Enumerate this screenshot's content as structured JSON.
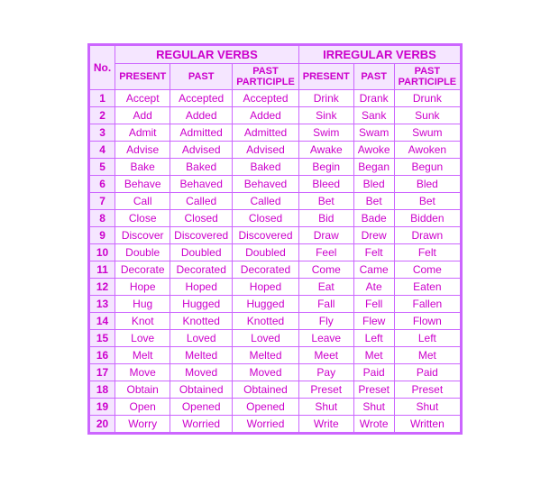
{
  "table": {
    "sections": {
      "regular": "REGULAR VERBS",
      "irregular": "IRREGULAR VERBS"
    },
    "col_headers": {
      "no": "No.",
      "present": "PRESENT",
      "past": "PAST",
      "past_participle": "PAST\nPARTICIPLE"
    },
    "rows": [
      {
        "no": "1",
        "r_present": "Accept",
        "r_past": "Accepted",
        "r_pp": "Accepted",
        "i_present": "Drink",
        "i_past": "Drank",
        "i_pp": "Drunk"
      },
      {
        "no": "2",
        "r_present": "Add",
        "r_past": "Added",
        "r_pp": "Added",
        "i_present": "Sink",
        "i_past": "Sank",
        "i_pp": "Sunk"
      },
      {
        "no": "3",
        "r_present": "Admit",
        "r_past": "Admitted",
        "r_pp": "Admitted",
        "i_present": "Swim",
        "i_past": "Swam",
        "i_pp": "Swum"
      },
      {
        "no": "4",
        "r_present": "Advise",
        "r_past": "Advised",
        "r_pp": "Advised",
        "i_present": "Awake",
        "i_past": "Awoke",
        "i_pp": "Awoken"
      },
      {
        "no": "5",
        "r_present": "Bake",
        "r_past": "Baked",
        "r_pp": "Baked",
        "i_present": "Begin",
        "i_past": "Began",
        "i_pp": "Begun"
      },
      {
        "no": "6",
        "r_present": "Behave",
        "r_past": "Behaved",
        "r_pp": "Behaved",
        "i_present": "Bleed",
        "i_past": "Bled",
        "i_pp": "Bled"
      },
      {
        "no": "7",
        "r_present": "Call",
        "r_past": "Called",
        "r_pp": "Called",
        "i_present": "Bet",
        "i_past": "Bet",
        "i_pp": "Bet"
      },
      {
        "no": "8",
        "r_present": "Close",
        "r_past": "Closed",
        "r_pp": "Closed",
        "i_present": "Bid",
        "i_past": "Bade",
        "i_pp": "Bidden"
      },
      {
        "no": "9",
        "r_present": "Discover",
        "r_past": "Discovered",
        "r_pp": "Discovered",
        "i_present": "Draw",
        "i_past": "Drew",
        "i_pp": "Drawn"
      },
      {
        "no": "10",
        "r_present": "Double",
        "r_past": "Doubled",
        "r_pp": "Doubled",
        "i_present": "Feel",
        "i_past": "Felt",
        "i_pp": "Felt"
      },
      {
        "no": "11",
        "r_present": "Decorate",
        "r_past": "Decorated",
        "r_pp": "Decorated",
        "i_present": "Come",
        "i_past": "Came",
        "i_pp": "Come"
      },
      {
        "no": "12",
        "r_present": "Hope",
        "r_past": "Hoped",
        "r_pp": "Hoped",
        "i_present": "Eat",
        "i_past": "Ate",
        "i_pp": "Eaten"
      },
      {
        "no": "13",
        "r_present": "Hug",
        "r_past": "Hugged",
        "r_pp": "Hugged",
        "i_present": "Fall",
        "i_past": "Fell",
        "i_pp": "Fallen"
      },
      {
        "no": "14",
        "r_present": "Knot",
        "r_past": "Knotted",
        "r_pp": "Knotted",
        "i_present": "Fly",
        "i_past": "Flew",
        "i_pp": "Flown"
      },
      {
        "no": "15",
        "r_present": "Love",
        "r_past": "Loved",
        "r_pp": "Loved",
        "i_present": "Leave",
        "i_past": "Left",
        "i_pp": "Left"
      },
      {
        "no": "16",
        "r_present": "Melt",
        "r_past": "Melted",
        "r_pp": "Melted",
        "i_present": "Meet",
        "i_past": "Met",
        "i_pp": "Met"
      },
      {
        "no": "17",
        "r_present": "Move",
        "r_past": "Moved",
        "r_pp": "Moved",
        "i_present": "Pay",
        "i_past": "Paid",
        "i_pp": "Paid"
      },
      {
        "no": "18",
        "r_present": "Obtain",
        "r_past": "Obtained",
        "r_pp": "Obtained",
        "i_present": "Preset",
        "i_past": "Preset",
        "i_pp": "Preset"
      },
      {
        "no": "19",
        "r_present": "Open",
        "r_past": "Opened",
        "r_pp": "Opened",
        "i_present": "Shut",
        "i_past": "Shut",
        "i_pp": "Shut"
      },
      {
        "no": "20",
        "r_present": "Worry",
        "r_past": "Worried",
        "r_pp": "Worried",
        "i_present": "Write",
        "i_past": "Wrote",
        "i_pp": "Written"
      }
    ]
  }
}
